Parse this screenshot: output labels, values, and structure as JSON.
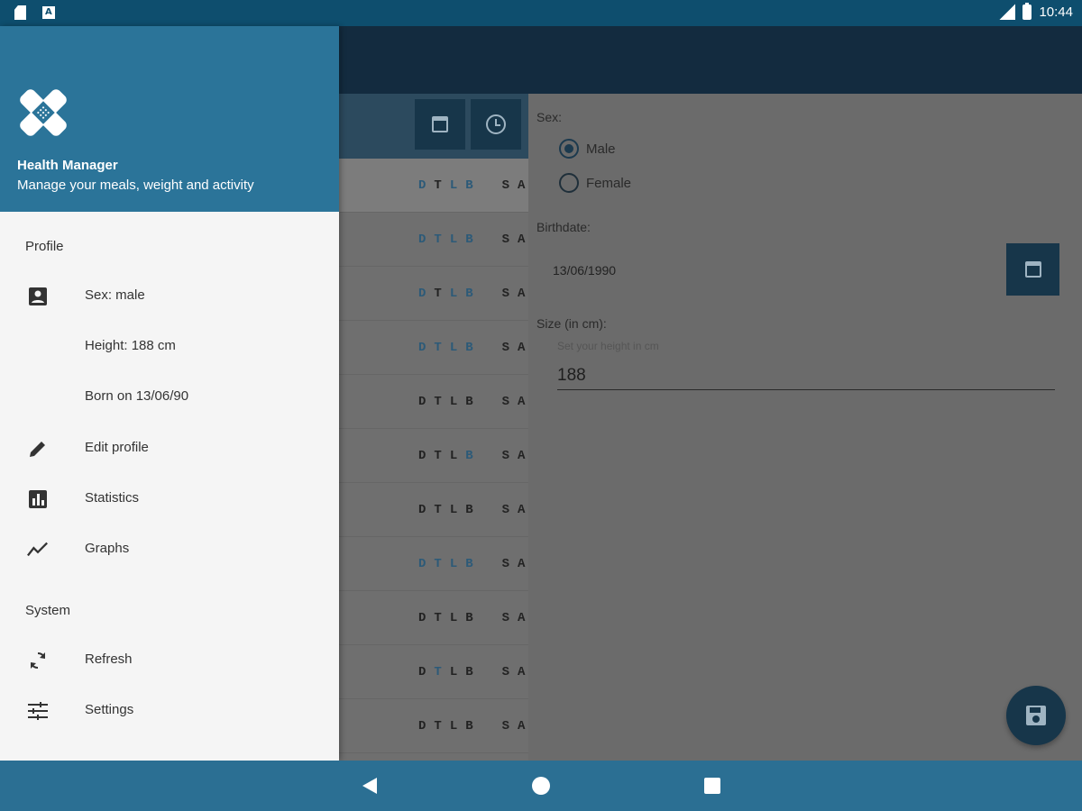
{
  "status_bar": {
    "time": "10:44"
  },
  "drawer": {
    "app_name": "Health Manager",
    "app_description": "Manage your meals, weight and activity",
    "sections": {
      "profile": "Profile",
      "system": "System"
    },
    "items": {
      "sex": "Sex: male",
      "height": "Height: 188 cm",
      "born": "Born on 13/06/90",
      "edit_profile": "Edit profile",
      "statistics": "Statistics",
      "graphs": "Graphs",
      "refresh": "Refresh",
      "settings": "Settings"
    }
  },
  "day_list": {
    "letters_left": [
      "D",
      "T",
      "L",
      "B"
    ],
    "letters_right": [
      "S",
      "A"
    ]
  },
  "profile_form": {
    "sex_label": "Sex:",
    "male": "Male",
    "female": "Female",
    "selected_sex": "Male",
    "birthdate_label": "Birthdate:",
    "birthdate_value": "13/06/1990",
    "size_label": "Size (in cm):",
    "size_hint": "Set your height in cm",
    "size_value": "188"
  },
  "colors": {
    "accent": "#2b7499",
    "status_bar": "#0e4e6e",
    "nav_bar": "#2b6f93",
    "highlight_letter": "#2c5a78"
  }
}
